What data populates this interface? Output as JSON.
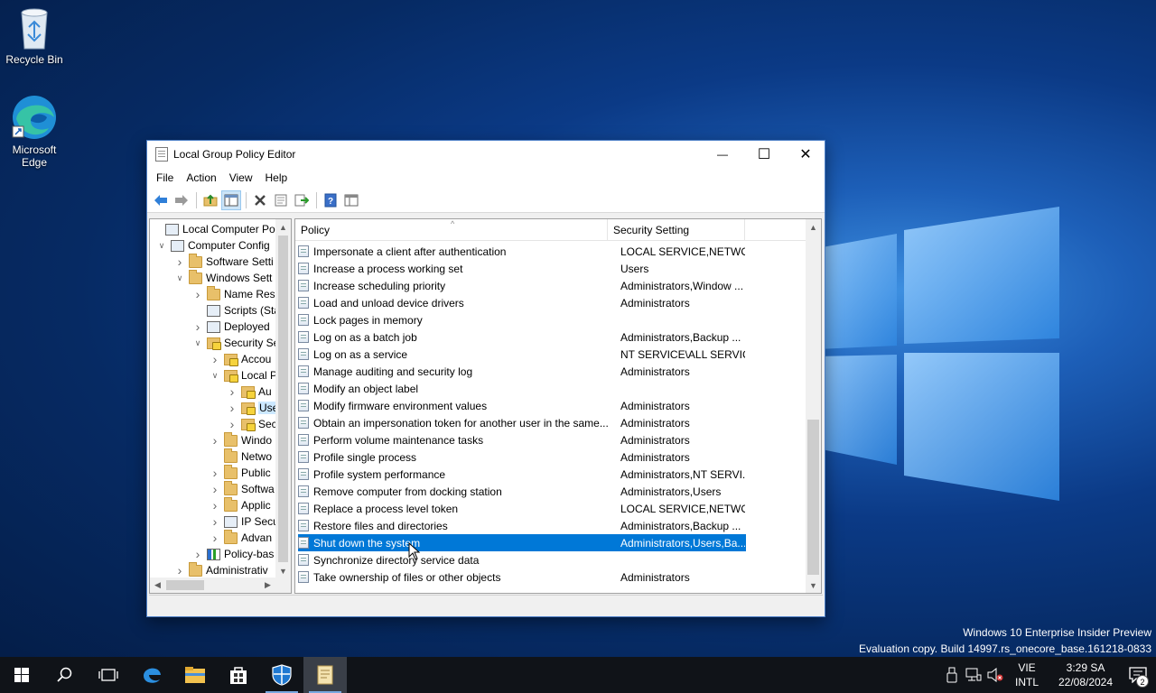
{
  "desktop": {
    "icons": [
      {
        "label": "Recycle Bin",
        "icon": "recycle-bin-icon"
      },
      {
        "label": "Microsoft Edge",
        "icon": "edge-icon"
      }
    ],
    "watermark": {
      "line1": "Windows 10 Enterprise Insider Preview",
      "line2": "Evaluation copy. Build 14997.rs_onecore_base.161218-0833"
    }
  },
  "window": {
    "title": "Local Group Policy Editor",
    "controls": {
      "minimize": "—",
      "maximize": "☐",
      "close": "✕"
    },
    "menu": [
      "File",
      "Action",
      "View",
      "Help"
    ],
    "toolbar": [
      "back-icon",
      "forward-icon",
      "up-folder-icon",
      "show-hide-tree-icon",
      "delete-icon",
      "properties-icon",
      "export-list-icon",
      "help-icon",
      "view-icon"
    ],
    "tree": [
      {
        "label": "Local Computer Polic",
        "expander": "",
        "icon": "computer-policy-icon"
      },
      {
        "label": "Computer Config",
        "expander": "v",
        "icon": "computer-icon"
      },
      {
        "label": "Software Setti",
        "expander": ">",
        "icon": "folder-icon"
      },
      {
        "label": "Windows Sett",
        "expander": "v",
        "icon": "folder-icon"
      },
      {
        "label": "Name Res",
        "expander": ">",
        "icon": "folder-icon"
      },
      {
        "label": "Scripts (Sta",
        "expander": "",
        "icon": "scripts-icon"
      },
      {
        "label": "Deployed",
        "expander": ">",
        "icon": "printer-icon"
      },
      {
        "label": "Security Se",
        "expander": "v",
        "icon": "security-icon"
      },
      {
        "label": "Accou",
        "expander": ">",
        "icon": "security-folder-icon"
      },
      {
        "label": "Local P",
        "expander": "v",
        "icon": "security-folder-icon"
      },
      {
        "label": "Au",
        "expander": ">",
        "icon": "security-folder-icon"
      },
      {
        "label": "Use",
        "expander": ">",
        "icon": "security-folder-icon",
        "selected": true
      },
      {
        "label": "Sec",
        "expander": ">",
        "icon": "security-folder-icon"
      },
      {
        "label": "Windo",
        "expander": ">",
        "icon": "folder-icon"
      },
      {
        "label": "Netwo",
        "expander": "",
        "icon": "folder-icon"
      },
      {
        "label": "Public",
        "expander": ">",
        "icon": "folder-icon"
      },
      {
        "label": "Softwa",
        "expander": ">",
        "icon": "folder-icon"
      },
      {
        "label": "Applic",
        "expander": ">",
        "icon": "folder-icon"
      },
      {
        "label": "IP Secu",
        "expander": ">",
        "icon": "ip-security-icon"
      },
      {
        "label": "Advan",
        "expander": ">",
        "icon": "folder-icon"
      },
      {
        "label": "Policy-bas",
        "expander": ">",
        "icon": "chart-icon"
      },
      {
        "label": "Administrativ",
        "expander": ">",
        "icon": "folder-icon"
      }
    ],
    "list": {
      "columns": [
        "Policy",
        "Security Setting"
      ],
      "rows": [
        {
          "policy": "Impersonate a client after authentication",
          "setting": "LOCAL SERVICE,NETWO..."
        },
        {
          "policy": "Increase a process working set",
          "setting": "Users"
        },
        {
          "policy": "Increase scheduling priority",
          "setting": "Administrators,Window ..."
        },
        {
          "policy": "Load and unload device drivers",
          "setting": "Administrators"
        },
        {
          "policy": "Lock pages in memory",
          "setting": ""
        },
        {
          "policy": "Log on as a batch job",
          "setting": "Administrators,Backup ..."
        },
        {
          "policy": "Log on as a service",
          "setting": "NT SERVICE\\ALL SERVIC..."
        },
        {
          "policy": "Manage auditing and security log",
          "setting": "Administrators"
        },
        {
          "policy": "Modify an object label",
          "setting": ""
        },
        {
          "policy": "Modify firmware environment values",
          "setting": "Administrators"
        },
        {
          "policy": "Obtain an impersonation token for another user in the same...",
          "setting": "Administrators"
        },
        {
          "policy": "Perform volume maintenance tasks",
          "setting": "Administrators"
        },
        {
          "policy": "Profile single process",
          "setting": "Administrators"
        },
        {
          "policy": "Profile system performance",
          "setting": "Administrators,NT SERVI..."
        },
        {
          "policy": "Remove computer from docking station",
          "setting": "Administrators,Users"
        },
        {
          "policy": "Replace a process level token",
          "setting": "LOCAL SERVICE,NETWO..."
        },
        {
          "policy": "Restore files and directories",
          "setting": "Administrators,Backup ..."
        },
        {
          "policy": "Shut down the system",
          "setting": "Administrators,Users,Ba...",
          "selected": true
        },
        {
          "policy": "Synchronize directory service data",
          "setting": ""
        },
        {
          "policy": "Take ownership of files or other objects",
          "setting": "Administrators"
        }
      ]
    }
  },
  "taskbar": {
    "items": [
      "start-icon",
      "search-icon",
      "task-view-icon",
      "edge-icon",
      "file-explorer-icon",
      "store-icon",
      "defender-icon",
      "notepad-icon"
    ],
    "tray": {
      "lang_top": "VIE",
      "lang_bottom": "INTL",
      "time": "3:29 SA",
      "date": "22/08/2024",
      "notifications": "2"
    }
  }
}
